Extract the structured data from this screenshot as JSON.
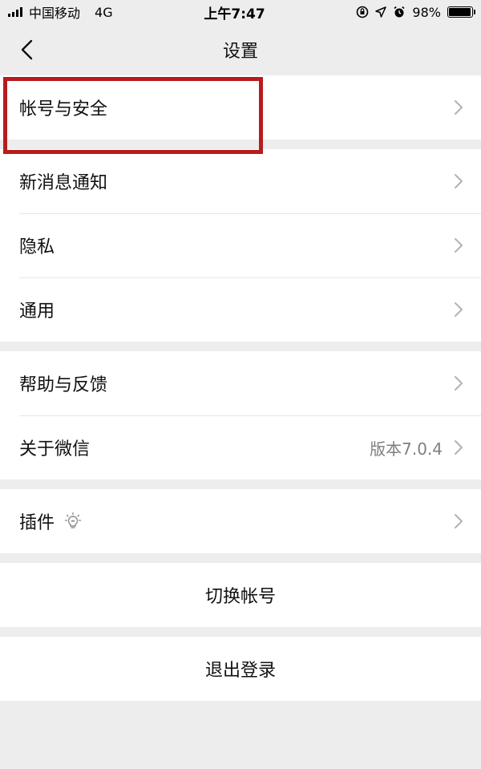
{
  "status_bar": {
    "carrier": "中国移动",
    "network": "4G",
    "time": "上午7:47",
    "battery_percent": "98%",
    "battery_level": 0.98
  },
  "nav": {
    "back_icon": "chevron-left-icon",
    "title": "设置"
  },
  "groups": [
    {
      "items": [
        {
          "label": "帐号与安全"
        }
      ]
    },
    {
      "items": [
        {
          "label": "新消息通知"
        },
        {
          "label": "隐私"
        },
        {
          "label": "通用"
        }
      ]
    },
    {
      "items": [
        {
          "label": "帮助与反馈"
        },
        {
          "label": "关于微信",
          "value": "版本7.0.4"
        }
      ]
    },
    {
      "items": [
        {
          "label": "插件",
          "icon": "lightbulb-icon"
        }
      ]
    }
  ],
  "actions": {
    "switch_account": "切换帐号",
    "logout": "退出登录"
  },
  "colors": {
    "background": "#ededed",
    "card": "#ffffff",
    "highlight": "#b71c1c",
    "secondary_text": "#7f7f7f"
  }
}
